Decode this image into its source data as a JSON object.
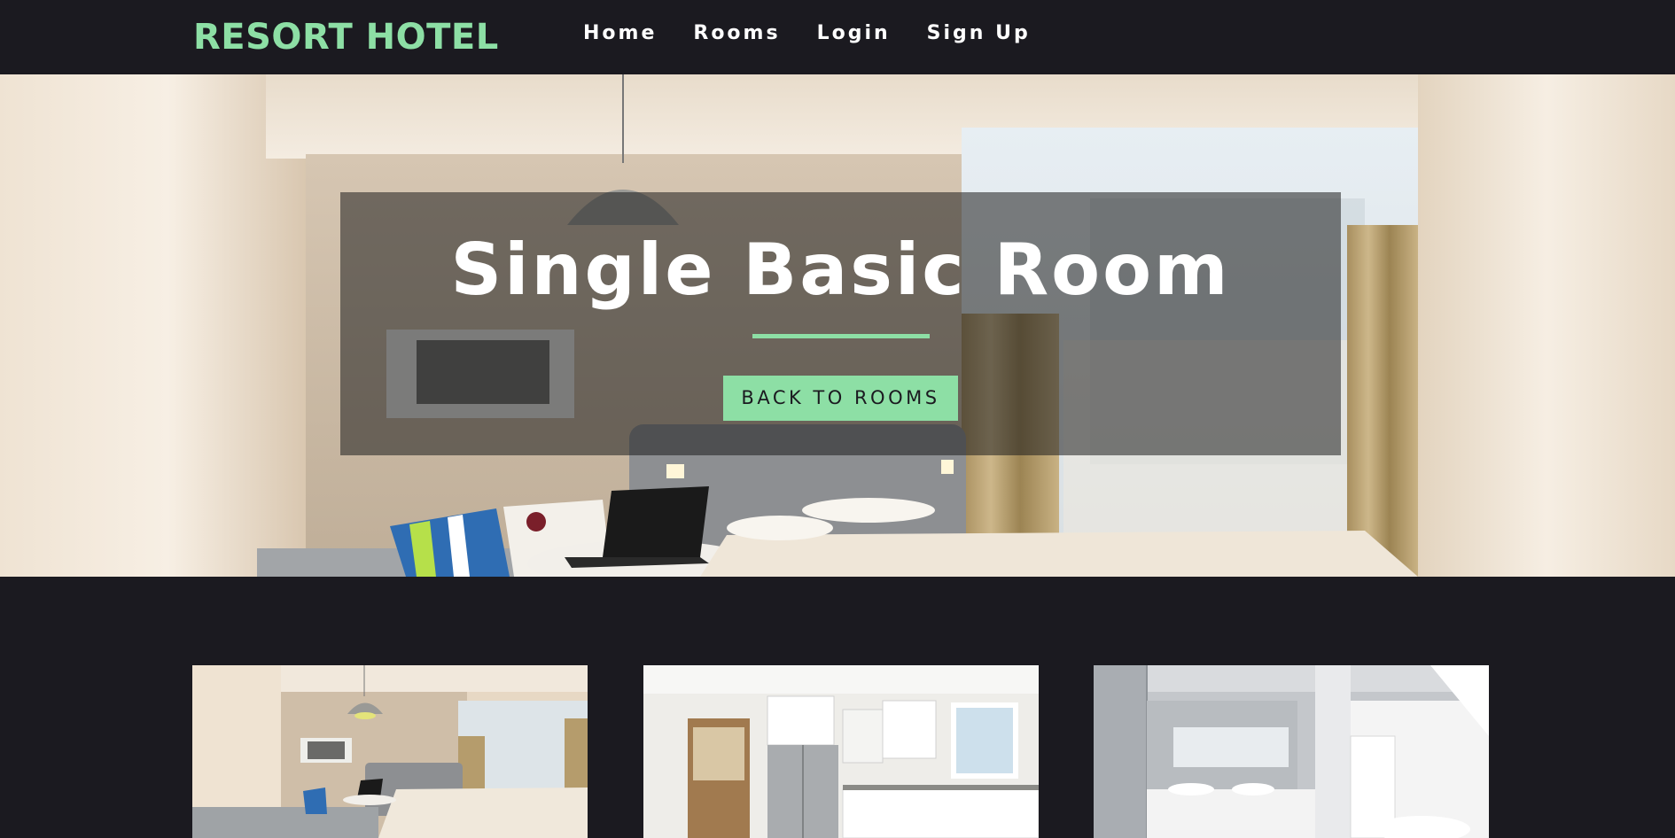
{
  "navbar": {
    "logo": "RESORT HOTEL",
    "links": [
      {
        "label": "Home"
      },
      {
        "label": "Rooms"
      },
      {
        "label": "Login"
      },
      {
        "label": "Sign Up"
      }
    ]
  },
  "hero": {
    "title": "Single Basic Room",
    "button_label": "BACK TO ROOMS"
  },
  "gallery": {
    "images": [
      {
        "name": "bedroom-photo"
      },
      {
        "name": "kitchen-photo"
      },
      {
        "name": "bathroom-photo"
      }
    ]
  },
  "colors": {
    "accent": "#8ddfa5",
    "background": "#1b1a20",
    "text": "#ffffff"
  }
}
